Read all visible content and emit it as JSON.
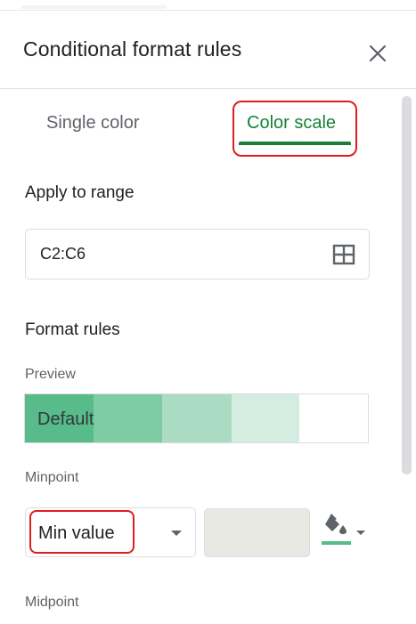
{
  "panel": {
    "title": "Conditional format rules"
  },
  "tabs": [
    {
      "label": "Single color",
      "active": false
    },
    {
      "label": "Color scale",
      "active": true
    }
  ],
  "apply_range": {
    "label": "Apply to range",
    "value": "C2:C6"
  },
  "format_rules": {
    "label": "Format rules",
    "preview_label": "Preview",
    "preview_text": "Default",
    "preview_colors": [
      "#57bb8a",
      "#7fcba4",
      "#abdbc3",
      "#d5ede1",
      "#ffffff"
    ]
  },
  "minpoint": {
    "label": "Minpoint",
    "type_value": "Min value",
    "fill_color": "#57bb8a"
  },
  "midpoint": {
    "label": "Midpoint"
  },
  "colors": {
    "accent": "#188038",
    "annotation_red": "#e01e1e"
  },
  "icons": [
    "close-icon",
    "grid-icon",
    "paint-bucket-icon",
    "chevron-down-icon"
  ]
}
